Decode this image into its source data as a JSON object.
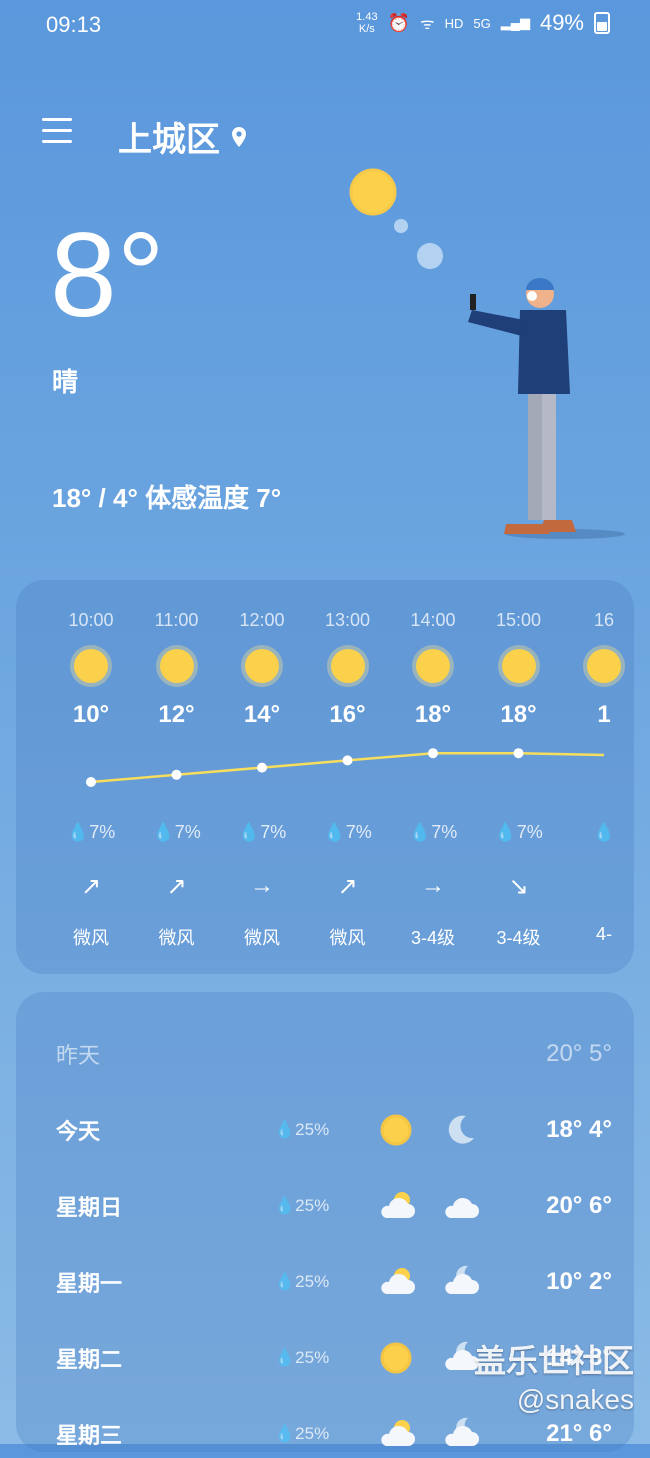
{
  "status_bar": {
    "time": "09:13",
    "net_speed": "1.43",
    "net_unit": "K/s",
    "hd": "HD",
    "signal": "5G",
    "battery": "49%"
  },
  "location": {
    "city": "上城区"
  },
  "current": {
    "temp": "8°",
    "condition": "晴",
    "range": "18° / 4° 体感温度 7°"
  },
  "hourly": [
    {
      "time": "10:00",
      "temp": "10°",
      "rain": "7%",
      "arrow": "↗",
      "wind": "微风"
    },
    {
      "time": "11:00",
      "temp": "12°",
      "rain": "7%",
      "arrow": "↗",
      "wind": "微风"
    },
    {
      "time": "12:00",
      "temp": "14°",
      "rain": "7%",
      "arrow": "→",
      "wind": "微风"
    },
    {
      "time": "13:00",
      "temp": "16°",
      "rain": "7%",
      "arrow": "↗",
      "wind": "微风"
    },
    {
      "time": "14:00",
      "temp": "18°",
      "rain": "7%",
      "arrow": "→",
      "wind": "3-4级"
    },
    {
      "time": "15:00",
      "temp": "18°",
      "rain": "7%",
      "arrow": "↘",
      "wind": "3-4级"
    },
    {
      "time": "16",
      "temp": "1",
      "rain": "",
      "arrow": "",
      "wind": "4-"
    }
  ],
  "hourly_temps": [
    10,
    12,
    14,
    16,
    18,
    18,
    17.5
  ],
  "daily": [
    {
      "day": "昨天",
      "rain": "",
      "icon1": "none",
      "icon2": "none",
      "temps": "20° 5°"
    },
    {
      "day": "今天",
      "rain": "25%",
      "icon1": "sun",
      "icon2": "moon",
      "temps": "18° 4°"
    },
    {
      "day": "星期日",
      "rain": "25%",
      "icon1": "sun-cloud",
      "icon2": "cloud",
      "temps": "20° 6°"
    },
    {
      "day": "星期一",
      "rain": "25%",
      "icon1": "sun-cloud",
      "icon2": "moon-cloud",
      "temps": "10° 2°"
    },
    {
      "day": "星期二",
      "rain": "25%",
      "icon1": "sun",
      "icon2": "moon-cloud",
      "temps": "14° 3°"
    },
    {
      "day": "星期三",
      "rain": "25%",
      "icon1": "sun-cloud",
      "icon2": "moon-cloud",
      "temps": "21° 6°"
    }
  ],
  "watermark": {
    "line1": "盖乐世社区",
    "line2": "@snakes"
  },
  "colors": {
    "sun": "#fbd14b",
    "curve": "#f6dd5e",
    "moon": "#cde0f2"
  }
}
